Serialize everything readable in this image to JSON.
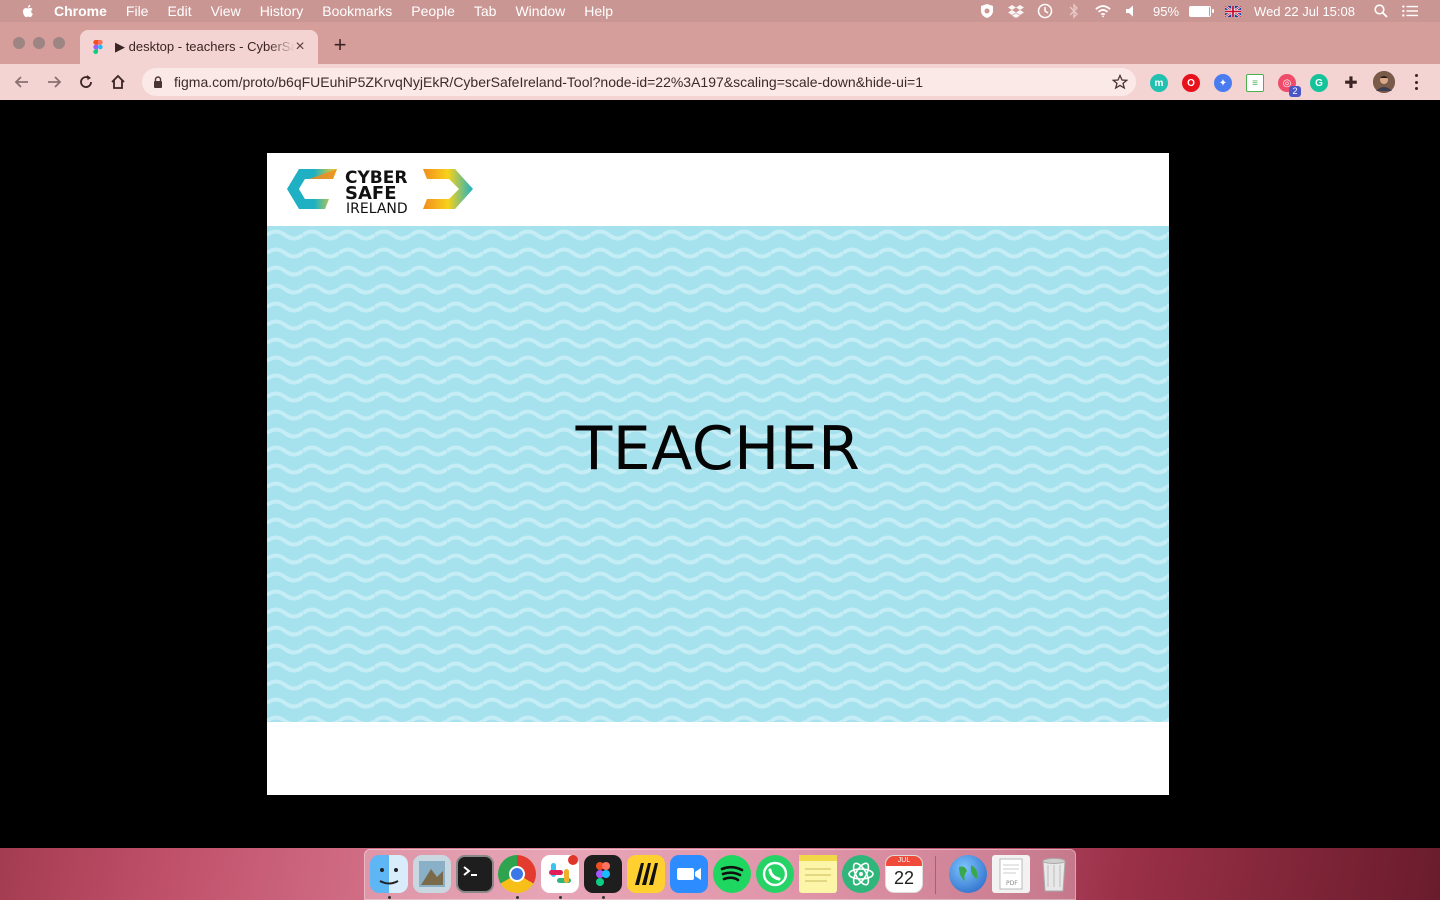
{
  "menubar": {
    "app": "Chrome",
    "items": [
      "File",
      "Edit",
      "View",
      "History",
      "Bookmarks",
      "People",
      "Tab",
      "Window",
      "Help"
    ],
    "battery": "95%",
    "battery_level": 0.95,
    "clock": "Wed 22 Jul  15:08"
  },
  "browser": {
    "tab_title": "▶ desktop - teachers - CyberSafeIreland",
    "url": "figma.com/proto/b6qFUEuhiP5ZKrvqNyjEkR/CyberSafeIreland-Tool?node-id=22%3A197&scaling=scale-down&hide-ui=1",
    "extension_badge": "2"
  },
  "page": {
    "logo": {
      "line1": "CYBER",
      "line2": "SAFE",
      "line3": "IRELAND"
    },
    "hero_title": "TEACHER"
  },
  "dock": {
    "calendar_month": "JUL",
    "calendar_day": "22"
  },
  "colors": {
    "menubar": "#c99693",
    "tabstrip": "#d59e9b",
    "hero_bg": "#a6e1ee",
    "wave": "#c5edf5",
    "logo_teal": "#1fb1c3",
    "logo_orange": "#f28c1e",
    "logo_yellow": "#f7d21b"
  }
}
